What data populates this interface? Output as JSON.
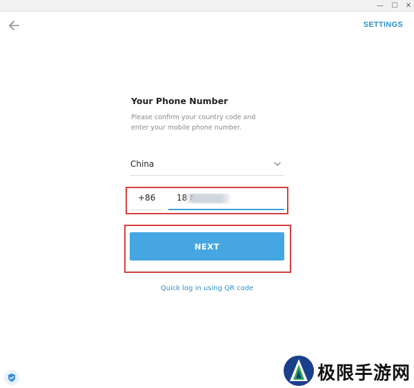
{
  "window": {
    "minimize_glyph": "—",
    "maximize_glyph": "☐",
    "close_glyph": "✕"
  },
  "header": {
    "back_icon": "arrow-left-icon",
    "settings_label": "SETTINGS"
  },
  "form": {
    "title": "Your Phone Number",
    "description": "Please confirm your country code and enter your mobile phone number.",
    "country": "China",
    "country_code": "+86",
    "phone_number": "18          8",
    "next_label": "NEXT",
    "qr_link": "Quick log in using QR code"
  },
  "colors": {
    "accent": "#2e8fc9",
    "button": "#45a6e2",
    "highlight_box": "#d43c3c"
  },
  "watermark": {
    "text": "极限手游网"
  }
}
